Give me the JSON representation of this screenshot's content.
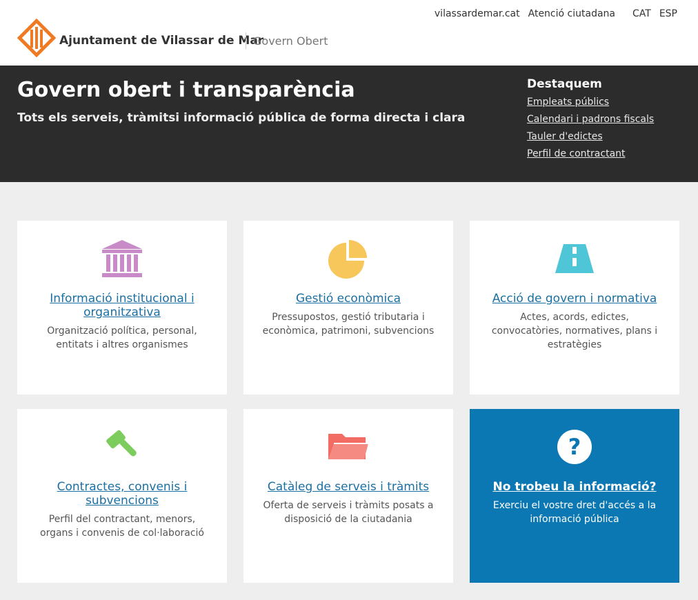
{
  "header": {
    "brand": "Ajuntament de Vilassar de Mar",
    "subbrand": "Govern Obert",
    "links": [
      "vilassardemar.cat",
      "Atenció ciutadana"
    ],
    "langs": [
      "CAT",
      "ESP"
    ]
  },
  "hero": {
    "title": "Govern obert i transparència",
    "subtitle": "Tots els serveis, tràmitsi informació pública de forma directa i clara",
    "highlights_title": "Destaquem",
    "highlights": [
      "Empleats públics",
      "Calendari i padrons fiscals",
      "Tauler d'edictes",
      "Perfil de contractant"
    ]
  },
  "cards": [
    {
      "icon": "institution-icon",
      "title": "Informació institucional i organitzativa",
      "desc": "Organització política, personal, entitats i altres organismes",
      "color": "#c98bc7"
    },
    {
      "icon": "pie-chart-icon",
      "title": "Gestió econòmica",
      "desc": "Pressupostos, gestió tributaria i econòmica, patrimoni, subvencions",
      "color": "#f8c75b"
    },
    {
      "icon": "road-icon",
      "title": "Acció de govern i normativa",
      "desc": "Actes, acords, edictes, convocatòries, normatives, plans i estratègies",
      "color": "#4fc6d8"
    },
    {
      "icon": "gavel-icon",
      "title": "Contractes, convenis i subvencions",
      "desc": "Perfil del contractant, menors, organs i convenis de col·laboració",
      "color": "#7ccd5e"
    },
    {
      "icon": "folder-icon",
      "title": "Catàleg de serveis i tràmits",
      "desc": "Oferta de serveis i tràmits posats a disposició de la ciutadania",
      "color": "#f26c63"
    },
    {
      "icon": "question-icon",
      "title": "No trobeu la informació?",
      "desc": "Exerciu el vostre dret d'accés a la informació pública",
      "color": "#ffffff"
    }
  ]
}
